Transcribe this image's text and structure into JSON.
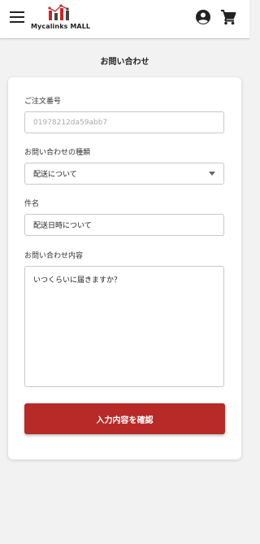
{
  "header": {
    "brand_name": "Mycalinks MALL",
    "icons": [
      "menu-icon",
      "account-circle-icon",
      "shopping-cart-icon"
    ],
    "brand_color": "#c62828"
  },
  "page": {
    "title": "お問い合わせ"
  },
  "form": {
    "order_number": {
      "label": "ご注文番号",
      "placeholder": "01978212da59abb7"
    },
    "inquiry_type": {
      "label": "お問い合わせの種類",
      "selected": "配送について"
    },
    "subject": {
      "label": "件名",
      "value": "配送日時について"
    },
    "content": {
      "label": "お問い合わせ内容",
      "value": "いつくらいに届きますか？"
    },
    "submit_label": "入力内容を確認",
    "submit_color": "#b72a28"
  }
}
